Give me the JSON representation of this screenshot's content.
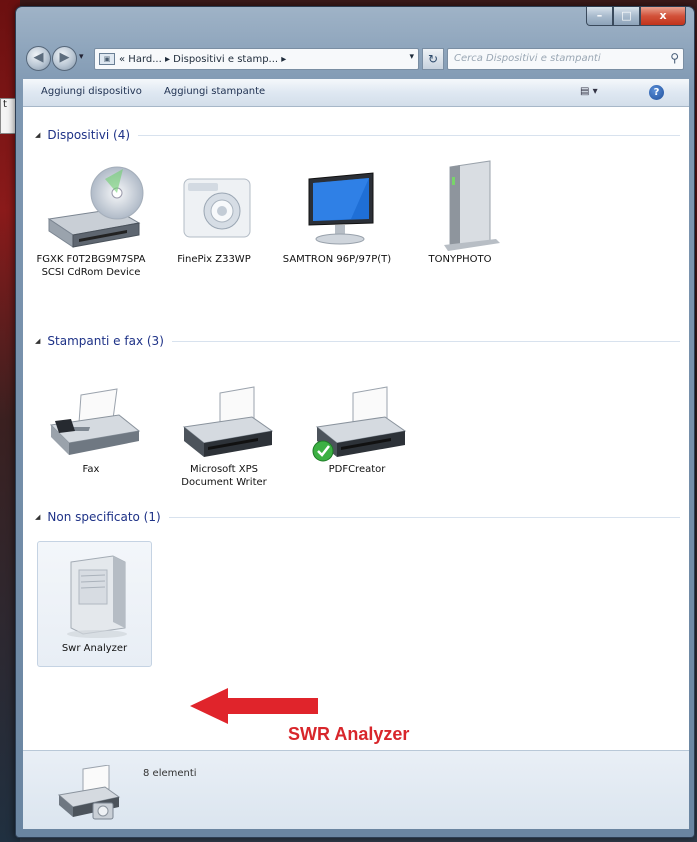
{
  "desktop": {
    "note_text": "t"
  },
  "window": {
    "caption": {
      "minimize": "–",
      "maximize": "□",
      "close": "x"
    }
  },
  "nav": {
    "back_icon": "back-arrow-icon",
    "forward_icon": "forward-arrow-icon",
    "address_text": "« Hard... ▸ Dispositivi e stamp... ▸",
    "search_placeholder": "Cerca Dispositivi e stampanti"
  },
  "toolbar": {
    "add_device": "Aggiungi dispositivo",
    "add_printer": "Aggiungi stampante",
    "view_icon": "view-options-icon",
    "help": "?"
  },
  "groups": [
    {
      "title": "Dispositivi (4)",
      "items": [
        {
          "label": "FGXK F0T2BG9M7SPA SCSI CdRom Device",
          "icon": "cdrom-drive-icon"
        },
        {
          "label": "FinePix Z33WP",
          "icon": "camera-icon"
        },
        {
          "label": "SAMTRON 96P/97P(T)",
          "icon": "monitor-icon"
        },
        {
          "label": "TONYPHOTO",
          "icon": "computer-tower-icon"
        }
      ]
    },
    {
      "title": "Stampanti e fax (3)",
      "items": [
        {
          "label": "Fax",
          "icon": "fax-icon"
        },
        {
          "label": "Microsoft XPS Document Writer",
          "icon": "printer-icon"
        },
        {
          "label": "PDFCreator",
          "icon": "printer-default-icon"
        }
      ]
    },
    {
      "title": "Non specificato (1)",
      "items": [
        {
          "label": "Swr Analyzer",
          "icon": "generic-device-icon"
        }
      ]
    }
  ],
  "annotation": {
    "text": "SWR Analyzer",
    "color": "#d8262b"
  },
  "status": {
    "count_text": "8 elementi"
  }
}
